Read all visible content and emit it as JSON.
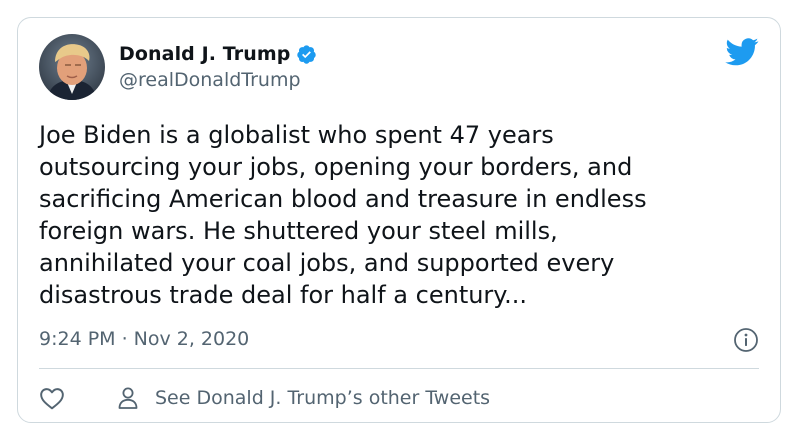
{
  "author": {
    "display_name": "Donald J. Trump",
    "handle": "@realDonaldTrump",
    "verified": true
  },
  "tweet": {
    "lines": [
      "Joe Biden is a globalist who spent 47 years",
      "outsourcing your jobs, opening your borders, and",
      "sacrificing American blood and treasure in endless",
      "foreign wars. He shuttered your steel mills,",
      "annihilated your coal jobs, and supported every",
      "disastrous trade deal for half a century..."
    ],
    "time": "9:24 PM",
    "separator": "·",
    "date": "Nov 2, 2020"
  },
  "actions": {
    "other_tweets_label": "See Donald J. Trump’s other Tweets"
  },
  "icons": {
    "brand": "twitter-bird-icon",
    "verified": "verified-badge-icon",
    "info": "info-icon",
    "like": "heart-icon",
    "profile": "person-icon"
  },
  "colors": {
    "twitter_blue": "#1d9bf0",
    "text": "#0f1419",
    "muted": "#536471",
    "border": "#cfd9de"
  }
}
